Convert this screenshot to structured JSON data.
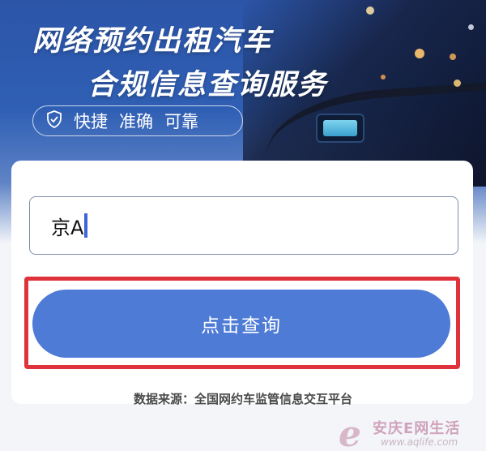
{
  "banner": {
    "title_line1": "网络预约出租汽车",
    "title_line2": "合规信息查询服务",
    "tagline_icon": "shield-check-icon",
    "tagline_items": [
      "快捷",
      "准确",
      "可靠"
    ]
  },
  "form": {
    "plate_input_value": "京A",
    "query_button_label": "点击查询",
    "highlight_color": "#e0323b"
  },
  "footer": {
    "source_text": "数据来源：全国网约车监管信息交互平台"
  },
  "watermark": {
    "letter": "e",
    "site_name": "安庆E网生活",
    "url": "www.aqlife.com"
  },
  "colors": {
    "banner_blue": "#2f5fb4",
    "button_blue": "#4e7bd6",
    "highlight_red": "#e0323b"
  }
}
